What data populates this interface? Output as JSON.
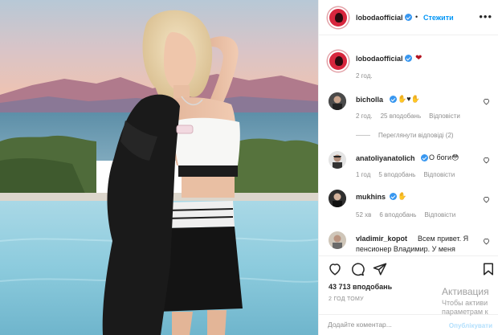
{
  "header": {
    "username": "lobodaofficial",
    "follow_label": "Стежити",
    "separator": "•",
    "more_icon": "more-horizontal-icon"
  },
  "caption": {
    "username": "lobodaofficial",
    "text": "❤",
    "time": "2 год."
  },
  "comments": [
    {
      "username": "bicholla",
      "text": "✋♥✋",
      "time": "2 год.",
      "likes": "25 вподобань",
      "reply_label": "Відповісти",
      "view_replies": "Переглянути відповіді (2)"
    },
    {
      "username": "anatoliyanatolich",
      "text": "О боги😳",
      "time": "1 год",
      "likes": "5 вподобань",
      "reply_label": "Відповісти"
    },
    {
      "username": "mukhins",
      "text": "✋",
      "time": "52 хв",
      "likes": "6 вподобань",
      "reply_label": "Відповісти"
    },
    {
      "username": "vladimir_kopot",
      "text": "Всем привет. Я",
      "text2": "пенсионер Владимир. У меня"
    }
  ],
  "actions": {
    "like_icon": "heart-icon",
    "comment_icon": "comment-icon",
    "share_icon": "share-icon",
    "save_icon": "bookmark-icon",
    "likes": "43 713 вподобань",
    "ago": "2 ГОД ТОМУ",
    "add_comment_placeholder": "Додайте коментар...",
    "publish_label": "Опублікувати"
  },
  "windows_watermark": {
    "line1": "Активация",
    "line2": "Чтобы активи",
    "line3": "параметрам к"
  },
  "colors": {
    "accent": "#0095f6",
    "verified": "#3897f0",
    "heart": "#ed4956",
    "muted": "#8e8e8e"
  }
}
